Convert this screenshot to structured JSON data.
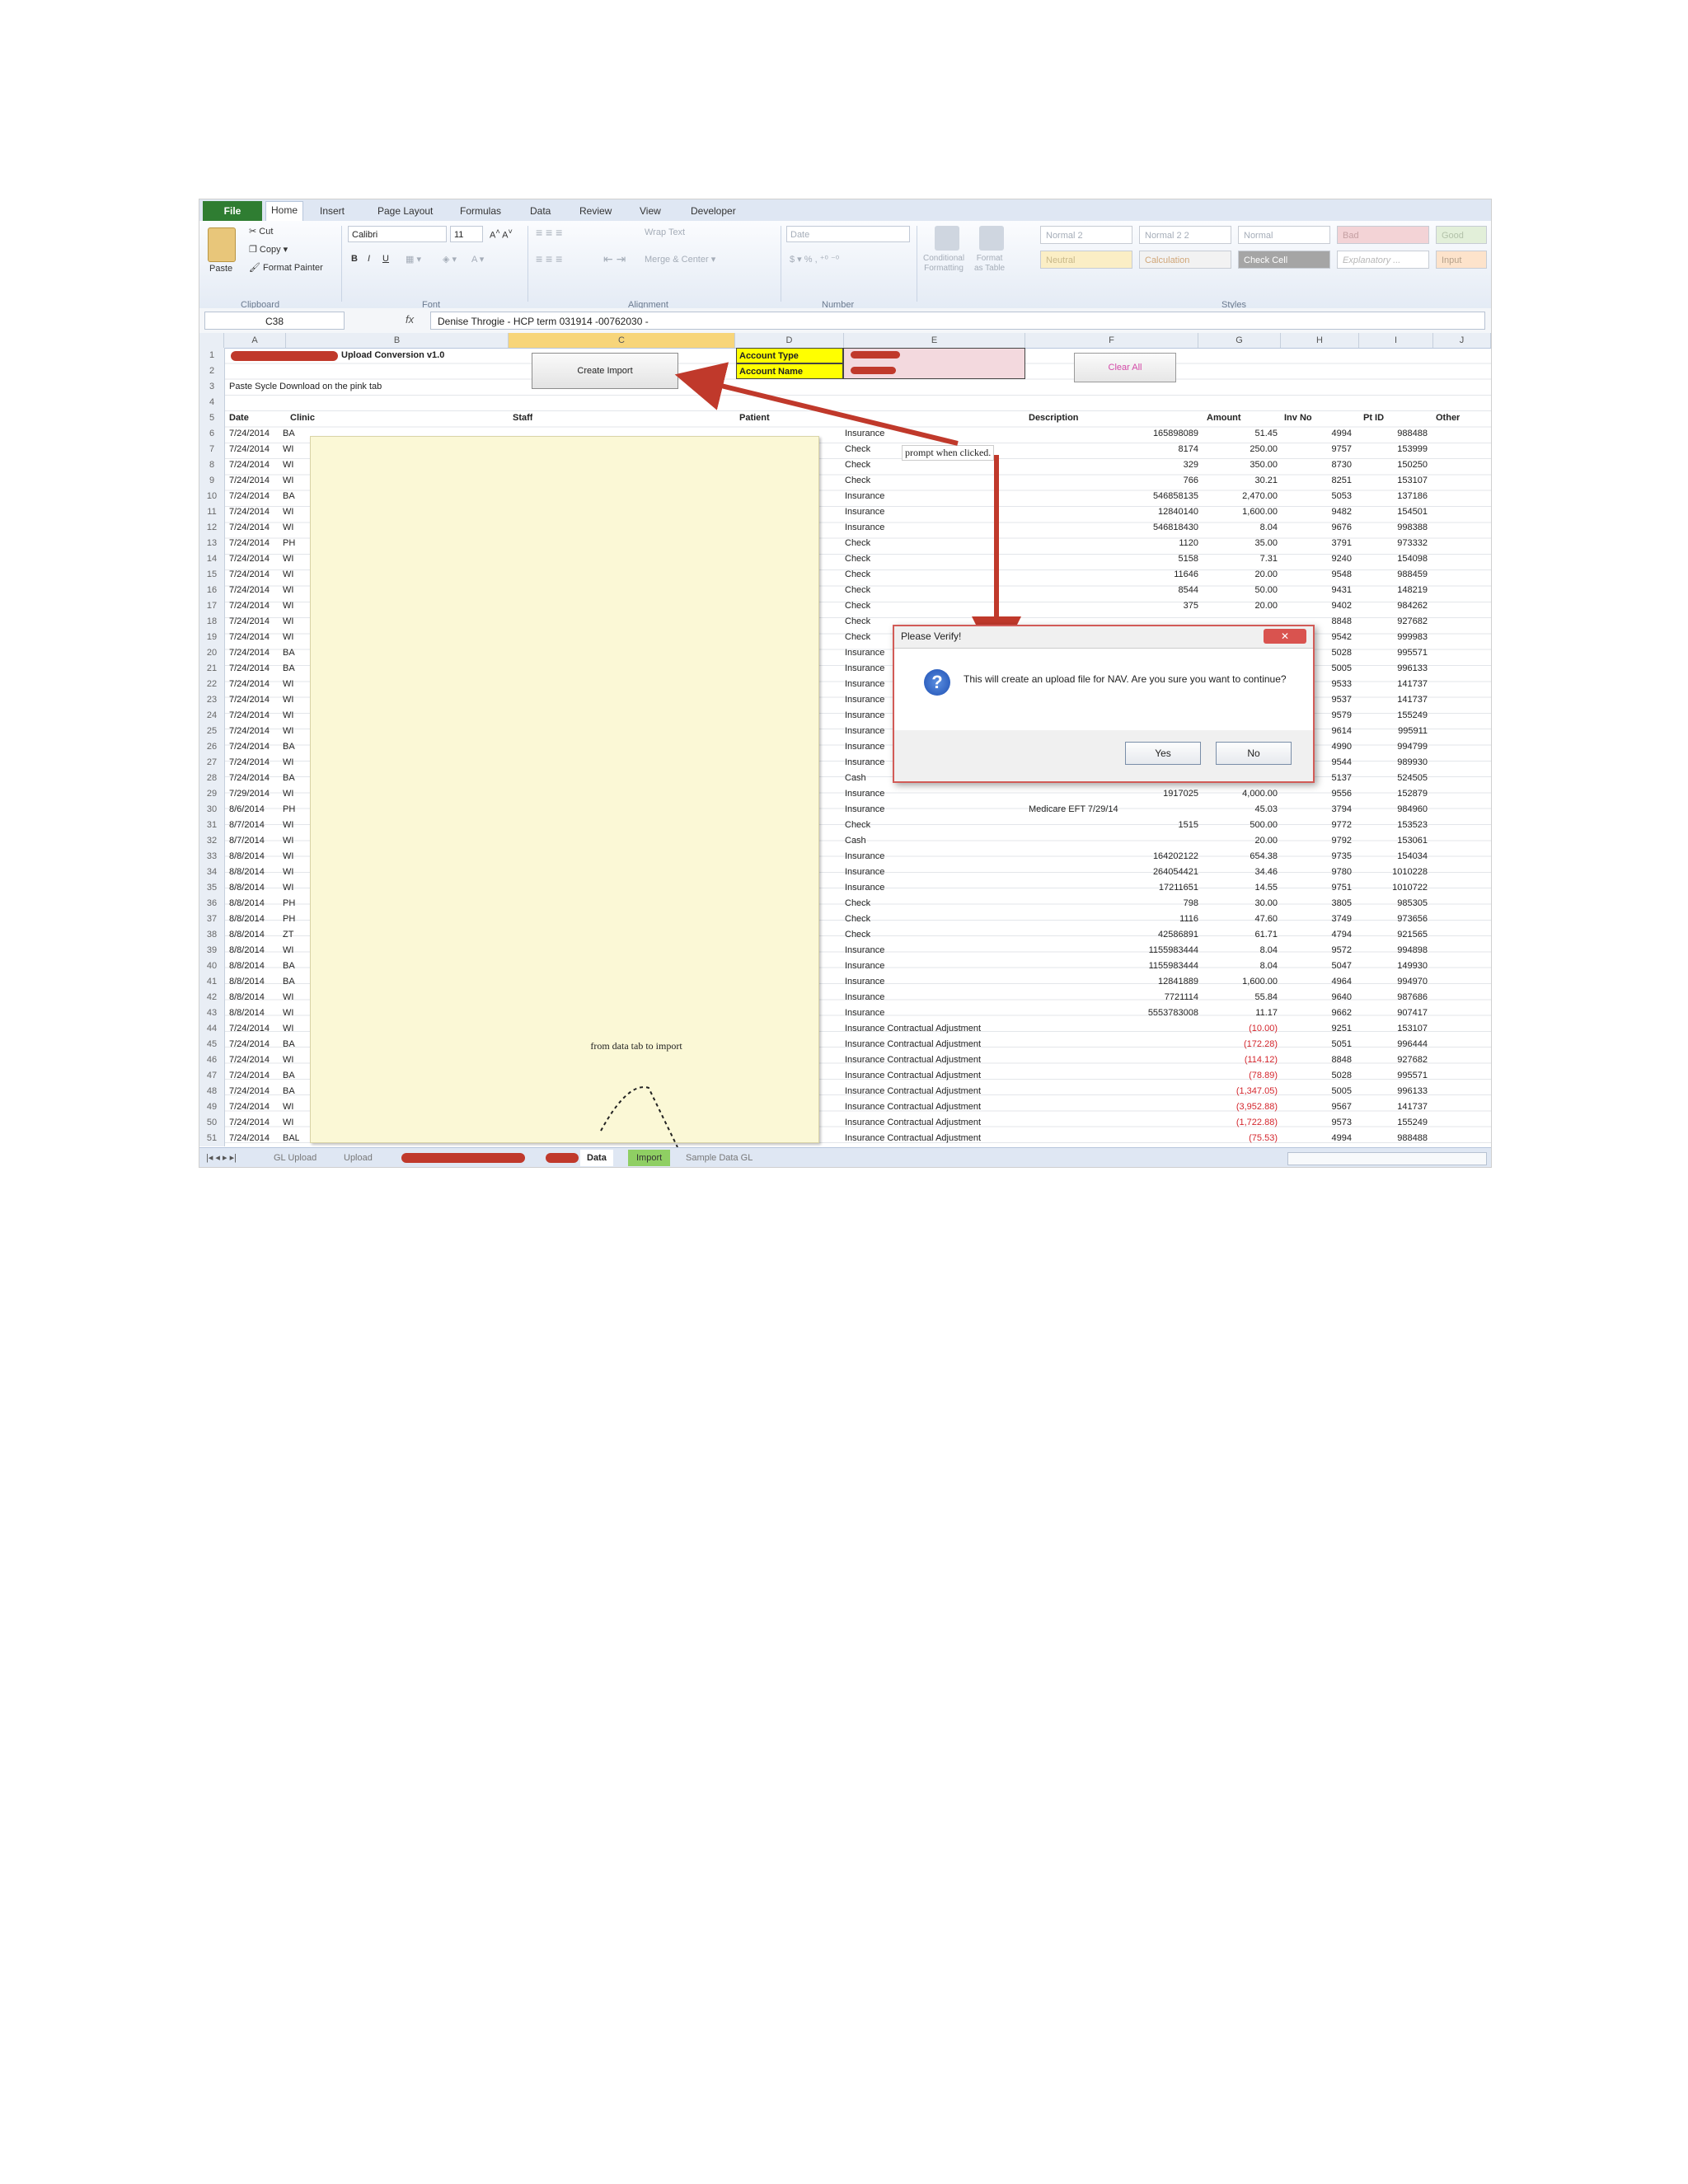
{
  "ribbon": {
    "tabs": [
      "File",
      "Home",
      "Insert",
      "Page Layout",
      "Formulas",
      "Data",
      "Review",
      "View",
      "Developer"
    ],
    "clipboard": {
      "paste": "Paste",
      "cut": "Cut",
      "copy": "Copy ▾",
      "format_painter": "Format Painter",
      "group": "Clipboard"
    },
    "font": {
      "name": "Calibri",
      "size": "11",
      "group": "Font"
    },
    "alignment": {
      "wrap": "Wrap Text",
      "merge": "Merge & Center ▾",
      "group": "Alignment"
    },
    "number": {
      "format": "Date",
      "group": "Number"
    },
    "styles_buttons": {
      "conditional": "Conditional\nFormatting",
      "format_table": "Format\nas Table"
    },
    "styles": {
      "items": [
        "Normal 2",
        "Normal 2 2",
        "Normal",
        "Bad",
        "Good",
        "Neutral",
        "Calculation",
        "Check Cell",
        "Explanatory ...",
        "Input"
      ],
      "group": "Styles"
    }
  },
  "formula_bar": {
    "name_box": "C38",
    "fx": "fx",
    "content": "Denise Throgie - HCP term 031914 -00762030 -"
  },
  "columns": [
    "A",
    "B",
    "C",
    "D",
    "E",
    "F",
    "G",
    "H",
    "I",
    "J"
  ],
  "top_cells": {
    "title": "Upload Conversion v1.0",
    "instruction": "Paste Sycle Download on the pink tab",
    "create_import": "Create Import",
    "account_type": "Account Type",
    "account_name": "Account Name",
    "clear_all": "Clear All"
  },
  "headers": {
    "date": "Date",
    "clinic": "Clinic",
    "staff": "Staff",
    "patient": "Patient",
    "description": "Description",
    "amount": "Amount",
    "inv": "Inv No",
    "pt": "Pt ID",
    "other": "Other"
  },
  "rows": [
    {
      "n": "6",
      "date": "7/24/2014",
      "clinic": "BA",
      "type": "Insurance",
      "ref": "165898089",
      "amt": "51.45",
      "inv": "4994",
      "pt": "988488"
    },
    {
      "n": "7",
      "date": "7/24/2014",
      "clinic": "WI",
      "type": "Check",
      "ref": "8174",
      "amt": "250.00",
      "inv": "9757",
      "pt": "153999"
    },
    {
      "n": "8",
      "date": "7/24/2014",
      "clinic": "WI",
      "type": "Check",
      "ref": "329",
      "amt": "350.00",
      "inv": "8730",
      "pt": "150250"
    },
    {
      "n": "9",
      "date": "7/24/2014",
      "clinic": "WI",
      "type": "Check",
      "ref": "766",
      "amt": "30.21",
      "inv": "8251",
      "pt": "153107"
    },
    {
      "n": "10",
      "date": "7/24/2014",
      "clinic": "BA",
      "type": "Insurance",
      "ref": "546858135",
      "amt": "2,470.00",
      "inv": "5053",
      "pt": "137186"
    },
    {
      "n": "11",
      "date": "7/24/2014",
      "clinic": "WI",
      "type": "Insurance",
      "ref": "12840140",
      "amt": "1,600.00",
      "inv": "9482",
      "pt": "154501"
    },
    {
      "n": "12",
      "date": "7/24/2014",
      "clinic": "WI",
      "type": "Insurance",
      "ref": "546818430",
      "amt": "8.04",
      "inv": "9676",
      "pt": "998388"
    },
    {
      "n": "13",
      "date": "7/24/2014",
      "clinic": "PH",
      "type": "Check",
      "ref": "1120",
      "amt": "35.00",
      "inv": "3791",
      "pt": "973332"
    },
    {
      "n": "14",
      "date": "7/24/2014",
      "clinic": "WI",
      "type": "Check",
      "ref": "5158",
      "amt": "7.31",
      "inv": "9240",
      "pt": "154098"
    },
    {
      "n": "15",
      "date": "7/24/2014",
      "clinic": "WI",
      "type": "Check",
      "ref": "11646",
      "amt": "20.00",
      "inv": "9548",
      "pt": "988459"
    },
    {
      "n": "16",
      "date": "7/24/2014",
      "clinic": "WI",
      "type": "Check",
      "ref": "8544",
      "amt": "50.00",
      "inv": "9431",
      "pt": "148219"
    },
    {
      "n": "17",
      "date": "7/24/2014",
      "clinic": "WI",
      "type": "Check",
      "ref": "375",
      "amt": "20.00",
      "inv": "9402",
      "pt": "984262"
    },
    {
      "n": "18",
      "date": "7/24/2014",
      "clinic": "WI",
      "type": "Check",
      "ref": "",
      "amt": "",
      "inv": "8848",
      "pt": "927682"
    },
    {
      "n": "19",
      "date": "7/24/2014",
      "clinic": "WI",
      "type": "Check",
      "ref": "",
      "amt": "",
      "inv": "9542",
      "pt": "999983"
    },
    {
      "n": "20",
      "date": "7/24/2014",
      "clinic": "BA",
      "type": "Insurance",
      "ref": "",
      "amt": "",
      "inv": "5028",
      "pt": "995571"
    },
    {
      "n": "21",
      "date": "7/24/2014",
      "clinic": "BA",
      "type": "Insurance",
      "ref": "",
      "amt": "",
      "inv": "5005",
      "pt": "996133"
    },
    {
      "n": "22",
      "date": "7/24/2014",
      "clinic": "WI",
      "type": "Insurance",
      "ref": "",
      "amt": "",
      "inv": "9533",
      "pt": "141737"
    },
    {
      "n": "23",
      "date": "7/24/2014",
      "clinic": "WI",
      "type": "Insurance",
      "ref": "",
      "amt": "",
      "inv": "9537",
      "pt": "141737"
    },
    {
      "n": "24",
      "date": "7/24/2014",
      "clinic": "WI",
      "type": "Insurance",
      "ref": "",
      "amt": "",
      "inv": "9579",
      "pt": "155249"
    },
    {
      "n": "25",
      "date": "7/24/2014",
      "clinic": "WI",
      "type": "Insurance",
      "ref": "",
      "amt": "",
      "inv": "9614",
      "pt": "995911"
    },
    {
      "n": "26",
      "date": "7/24/2014",
      "clinic": "BA",
      "type": "Insurance",
      "ref": "",
      "amt": "",
      "inv": "4990",
      "pt": "994799"
    },
    {
      "n": "27",
      "date": "7/24/2014",
      "clinic": "WI",
      "type": "Insurance",
      "ref": "",
      "amt": "",
      "inv": "9544",
      "pt": "989930"
    },
    {
      "n": "28",
      "date": "7/24/2014",
      "clinic": "BA",
      "type": "Cash",
      "ref": "",
      "amt": "",
      "inv": "5137",
      "pt": "524505"
    },
    {
      "n": "29",
      "date": "7/29/2014",
      "clinic": "WI",
      "type": "Insurance",
      "ref": "1917025",
      "amt": "4,000.00",
      "inv": "9556",
      "pt": "152879"
    },
    {
      "n": "30",
      "date": "8/6/2014",
      "clinic": "PH",
      "type": "Insurance",
      "ref": "",
      "amt": "45.03",
      "inv": "3794",
      "pt": "984960",
      "desc": "Medicare EFT 7/29/14"
    },
    {
      "n": "31",
      "date": "8/7/2014",
      "clinic": "WI",
      "type": "Check",
      "ref": "1515",
      "amt": "500.00",
      "inv": "9772",
      "pt": "153523"
    },
    {
      "n": "32",
      "date": "8/7/2014",
      "clinic": "WI",
      "type": "Cash",
      "ref": "",
      "amt": "20.00",
      "inv": "9792",
      "pt": "153061"
    },
    {
      "n": "33",
      "date": "8/8/2014",
      "clinic": "WI",
      "type": "Insurance",
      "ref": "164202122",
      "amt": "654.38",
      "inv": "9735",
      "pt": "154034"
    },
    {
      "n": "34",
      "date": "8/8/2014",
      "clinic": "WI",
      "type": "Insurance",
      "ref": "264054421",
      "amt": "34.46",
      "inv": "9780",
      "pt": "1010228"
    },
    {
      "n": "35",
      "date": "8/8/2014",
      "clinic": "WI",
      "type": "Insurance",
      "ref": "17211651",
      "amt": "14.55",
      "inv": "9751",
      "pt": "1010722"
    },
    {
      "n": "36",
      "date": "8/8/2014",
      "clinic": "PH",
      "type": "Check",
      "ref": "798",
      "amt": "30.00",
      "inv": "3805",
      "pt": "985305"
    },
    {
      "n": "37",
      "date": "8/8/2014",
      "clinic": "PH",
      "type": "Check",
      "ref": "1116",
      "amt": "47.60",
      "inv": "3749",
      "pt": "973656"
    },
    {
      "n": "38",
      "date": "8/8/2014",
      "clinic": "ZT",
      "type": "Check",
      "ref": "42586891",
      "amt": "61.71",
      "inv": "4794",
      "pt": "921565"
    },
    {
      "n": "39",
      "date": "8/8/2014",
      "clinic": "WI",
      "type": "Insurance",
      "ref": "1155983444",
      "amt": "8.04",
      "inv": "9572",
      "pt": "994898"
    },
    {
      "n": "40",
      "date": "8/8/2014",
      "clinic": "BA",
      "type": "Insurance",
      "ref": "1155983444",
      "amt": "8.04",
      "inv": "5047",
      "pt": "149930"
    },
    {
      "n": "41",
      "date": "8/8/2014",
      "clinic": "BA",
      "type": "Insurance",
      "ref": "12841889",
      "amt": "1,600.00",
      "inv": "4964",
      "pt": "994970"
    },
    {
      "n": "42",
      "date": "8/8/2014",
      "clinic": "WI",
      "type": "Insurance",
      "ref": "7721114",
      "amt": "55.84",
      "inv": "9640",
      "pt": "987686"
    },
    {
      "n": "43",
      "date": "8/8/2014",
      "clinic": "WI",
      "type": "Insurance",
      "ref": "5553783008",
      "amt": "11.17",
      "inv": "9662",
      "pt": "907417"
    },
    {
      "n": "44",
      "date": "7/24/2014",
      "clinic": "WI",
      "type": "Insurance Contractual Adjustment",
      "ref": "",
      "amt": "(10.00)",
      "inv": "9251",
      "pt": "153107",
      "neg": true
    },
    {
      "n": "45",
      "date": "7/24/2014",
      "clinic": "BA",
      "type": "Insurance Contractual Adjustment",
      "ref": "",
      "amt": "(172.28)",
      "inv": "5051",
      "pt": "996444",
      "neg": true
    },
    {
      "n": "46",
      "date": "7/24/2014",
      "clinic": "WI",
      "type": "Insurance Contractual Adjustment",
      "ref": "",
      "amt": "(114.12)",
      "inv": "8848",
      "pt": "927682",
      "neg": true
    },
    {
      "n": "47",
      "date": "7/24/2014",
      "clinic": "BA",
      "type": "Insurance Contractual Adjustment",
      "ref": "",
      "amt": "(78.89)",
      "inv": "5028",
      "pt": "995571",
      "neg": true
    },
    {
      "n": "48",
      "date": "7/24/2014",
      "clinic": "BA",
      "type": "Insurance Contractual Adjustment",
      "ref": "",
      "amt": "(1,347.05)",
      "inv": "5005",
      "pt": "996133",
      "neg": true
    },
    {
      "n": "49",
      "date": "7/24/2014",
      "clinic": "WI",
      "type": "Insurance Contractual Adjustment",
      "ref": "",
      "amt": "(3,952.88)",
      "inv": "9567",
      "pt": "141737",
      "neg": true
    },
    {
      "n": "50",
      "date": "7/24/2014",
      "clinic": "WI",
      "type": "Insurance Contractual Adjustment",
      "ref": "",
      "amt": "(1,722.88)",
      "inv": "9573",
      "pt": "155249",
      "neg": true
    },
    {
      "n": "51",
      "date": "7/24/2014",
      "clinic": "BAL",
      "type": "Insurance Contractual Adjustment",
      "ref": "",
      "amt": "(75.53)",
      "inv": "4994",
      "pt": "988488",
      "neg": true
    }
  ],
  "annotations": {
    "prompt": "prompt when clicked.",
    "from_data": "from data tab to import"
  },
  "dialog": {
    "title": "Please Verify!",
    "message": "This will create an upload file for NAV. Are you sure you want to continue?",
    "yes": "Yes",
    "no": "No"
  },
  "sheet_tabs": [
    "GL Upload",
    "Upload",
    "Data",
    "Import",
    "Sample Data GL"
  ]
}
